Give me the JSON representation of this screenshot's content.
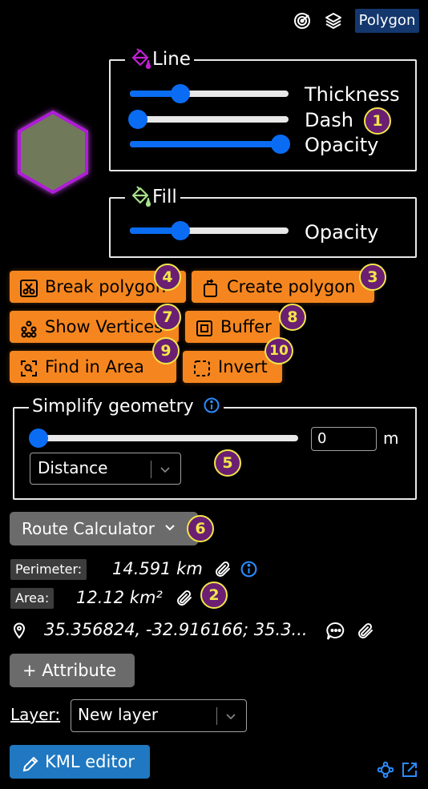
{
  "toolbar": {
    "geometry_badge": "Polygon",
    "icons": [
      "radar-icon",
      "layers-icon"
    ]
  },
  "line_section": {
    "legend": "Line",
    "legend_icon": "paint-bucket-icon",
    "sliders": [
      {
        "label": "Thickness",
        "value": 0.4
      },
      {
        "label": "Dash",
        "value": 0.0
      },
      {
        "label": "Opacity",
        "value": 1.0
      }
    ]
  },
  "fill_section": {
    "legend": "Fill",
    "legend_icon": "paint-bucket-icon",
    "sliders": [
      {
        "label": "Opacity",
        "value": 0.4
      }
    ]
  },
  "actions": {
    "break_polygon": "Break polygon",
    "create_polygon": "Create polygon",
    "show_vertices": "Show Vertices",
    "buffer": "Buffer",
    "find_in_area": "Find in Area",
    "invert": "Invert"
  },
  "badges": {
    "b1": "1",
    "b2": "2",
    "b3": "3",
    "b4": "4",
    "b5": "5",
    "b6": "6",
    "b7": "7",
    "b8": "8",
    "b9": "9",
    "b10": "10"
  },
  "simplify": {
    "legend": "Simplify geometry",
    "slider_value": 0.0,
    "input_value": "0",
    "unit": "m",
    "method": "Distance"
  },
  "route_calculator": "Route Calculator",
  "measurements": {
    "perimeter_label": "Perimeter:",
    "perimeter_value": "14.591 km",
    "area_label": "Area:",
    "area_value": "12.12 km²",
    "coordinates": "35.356824, -32.916166; 35.3..."
  },
  "attribute_button": "+ Attribute",
  "layer": {
    "label": "Layer:",
    "value": "New layer"
  },
  "kml_editor": "KML editor",
  "colors": {
    "accent_blue": "#0a6cf2",
    "action_orange": "#f5861f",
    "polygon_stroke": "#b01ed8",
    "polygon_fill": "#6f7a5a",
    "badge_fill": "#6a1f73",
    "badge_text": "#f2e64a"
  }
}
